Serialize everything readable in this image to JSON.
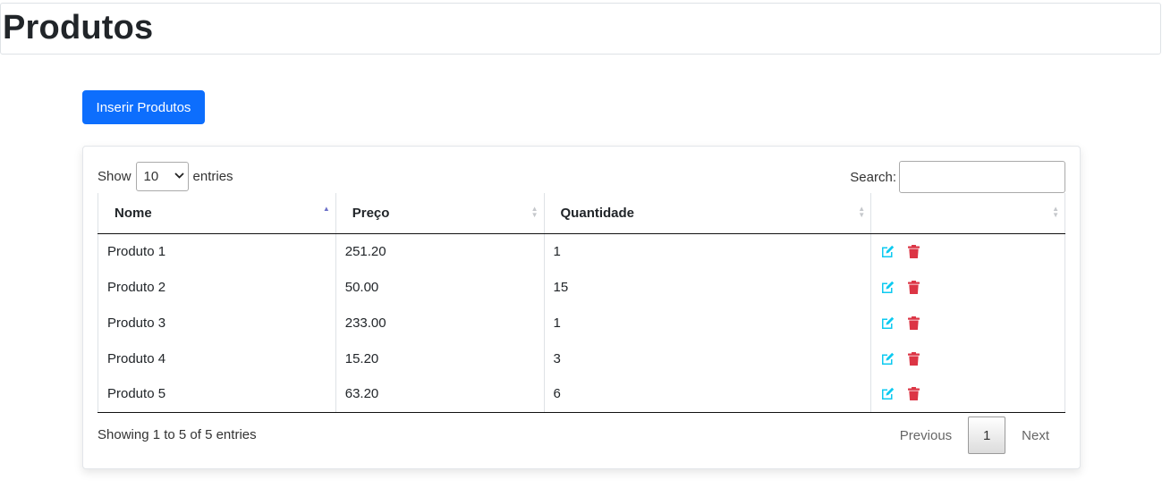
{
  "page": {
    "title": "Produtos"
  },
  "toolbar": {
    "insert_label": "Inserir Produtos"
  },
  "length": {
    "prefix": "Show",
    "value": "10",
    "suffix": "entries"
  },
  "search": {
    "label": "Search:",
    "value": ""
  },
  "table": {
    "headers": [
      "Nome",
      "Preço",
      "Quantidade",
      ""
    ],
    "rows": [
      {
        "nome": "Produto 1",
        "preco": "251.20",
        "quantidade": "1"
      },
      {
        "nome": "Produto 2",
        "preco": "50.00",
        "quantidade": "15"
      },
      {
        "nome": "Produto 3",
        "preco": "233.00",
        "quantidade": "1"
      },
      {
        "nome": "Produto 4",
        "preco": "15.20",
        "quantidade": "3"
      },
      {
        "nome": "Produto 5",
        "preco": "63.20",
        "quantidade": "6"
      }
    ],
    "row_actions": [
      "edit-icon",
      "trash-icon"
    ]
  },
  "footer": {
    "info": "Showing 1 to 5 of 5 entries",
    "previous_label": "Previous",
    "current_page": "1",
    "next_label": "Next"
  },
  "colors": {
    "primary": "#0d6efd",
    "edit_icon": "#0dcaf0",
    "delete_icon": "#dc3545",
    "sort_active": "#6c70c8"
  }
}
